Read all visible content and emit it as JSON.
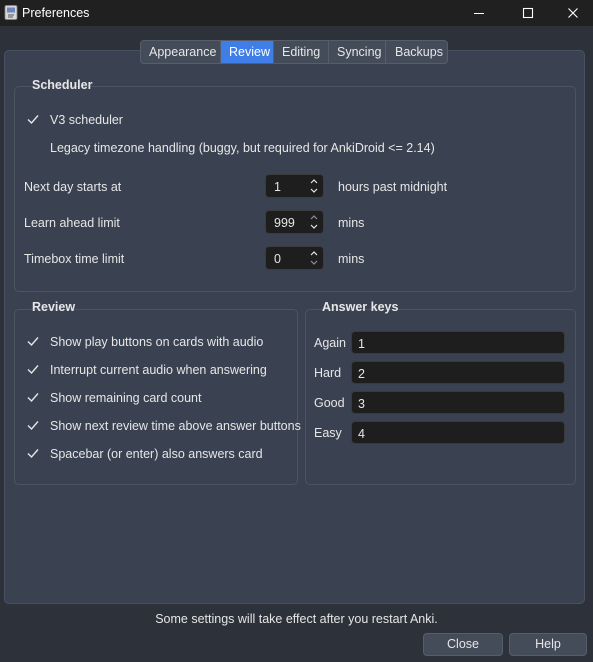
{
  "window": {
    "title": "Preferences",
    "icon": "anki-app-icon",
    "controls": [
      "minimize-icon",
      "maximize-icon",
      "close-icon"
    ]
  },
  "tabs": [
    {
      "label": "Appearance",
      "active": false
    },
    {
      "label": "Review",
      "active": true
    },
    {
      "label": "Editing",
      "active": false
    },
    {
      "label": "Syncing",
      "active": false
    },
    {
      "label": "Backups",
      "active": false
    }
  ],
  "scheduler": {
    "title": "Scheduler",
    "v3_label": "V3 scheduler",
    "v3_checked": true,
    "legacy_label": "Legacy timezone handling (buggy, but required for AnkiDroid <= 2.14)",
    "legacy_checked": false,
    "next_day": {
      "label": "Next day starts at",
      "value": "1",
      "unit": "hours past midnight"
    },
    "learn_ahead": {
      "label": "Learn ahead limit",
      "value": "999",
      "unit": "mins"
    },
    "timebox": {
      "label": "Timebox time limit",
      "value": "0",
      "unit": "mins"
    }
  },
  "review": {
    "title": "Review",
    "options": [
      {
        "label": "Show play buttons on cards with audio",
        "checked": true
      },
      {
        "label": "Interrupt current audio when answering",
        "checked": true
      },
      {
        "label": "Show remaining card count",
        "checked": true
      },
      {
        "label": "Show next review time above answer buttons",
        "checked": true
      },
      {
        "label": "Spacebar (or enter) also answers card",
        "checked": true
      }
    ]
  },
  "answer_keys": {
    "title": "Answer keys",
    "keys": [
      {
        "label": "Again",
        "value": "1"
      },
      {
        "label": "Hard",
        "value": "2"
      },
      {
        "label": "Good",
        "value": "3"
      },
      {
        "label": "Easy",
        "value": "4"
      }
    ]
  },
  "footer": {
    "note": "Some settings will take effect after you restart Anki.",
    "close_label": "Close",
    "help_label": "Help"
  },
  "colors": {
    "accent": "#3f7ee8",
    "panel": "#3a4251",
    "background": "#2c313a"
  }
}
